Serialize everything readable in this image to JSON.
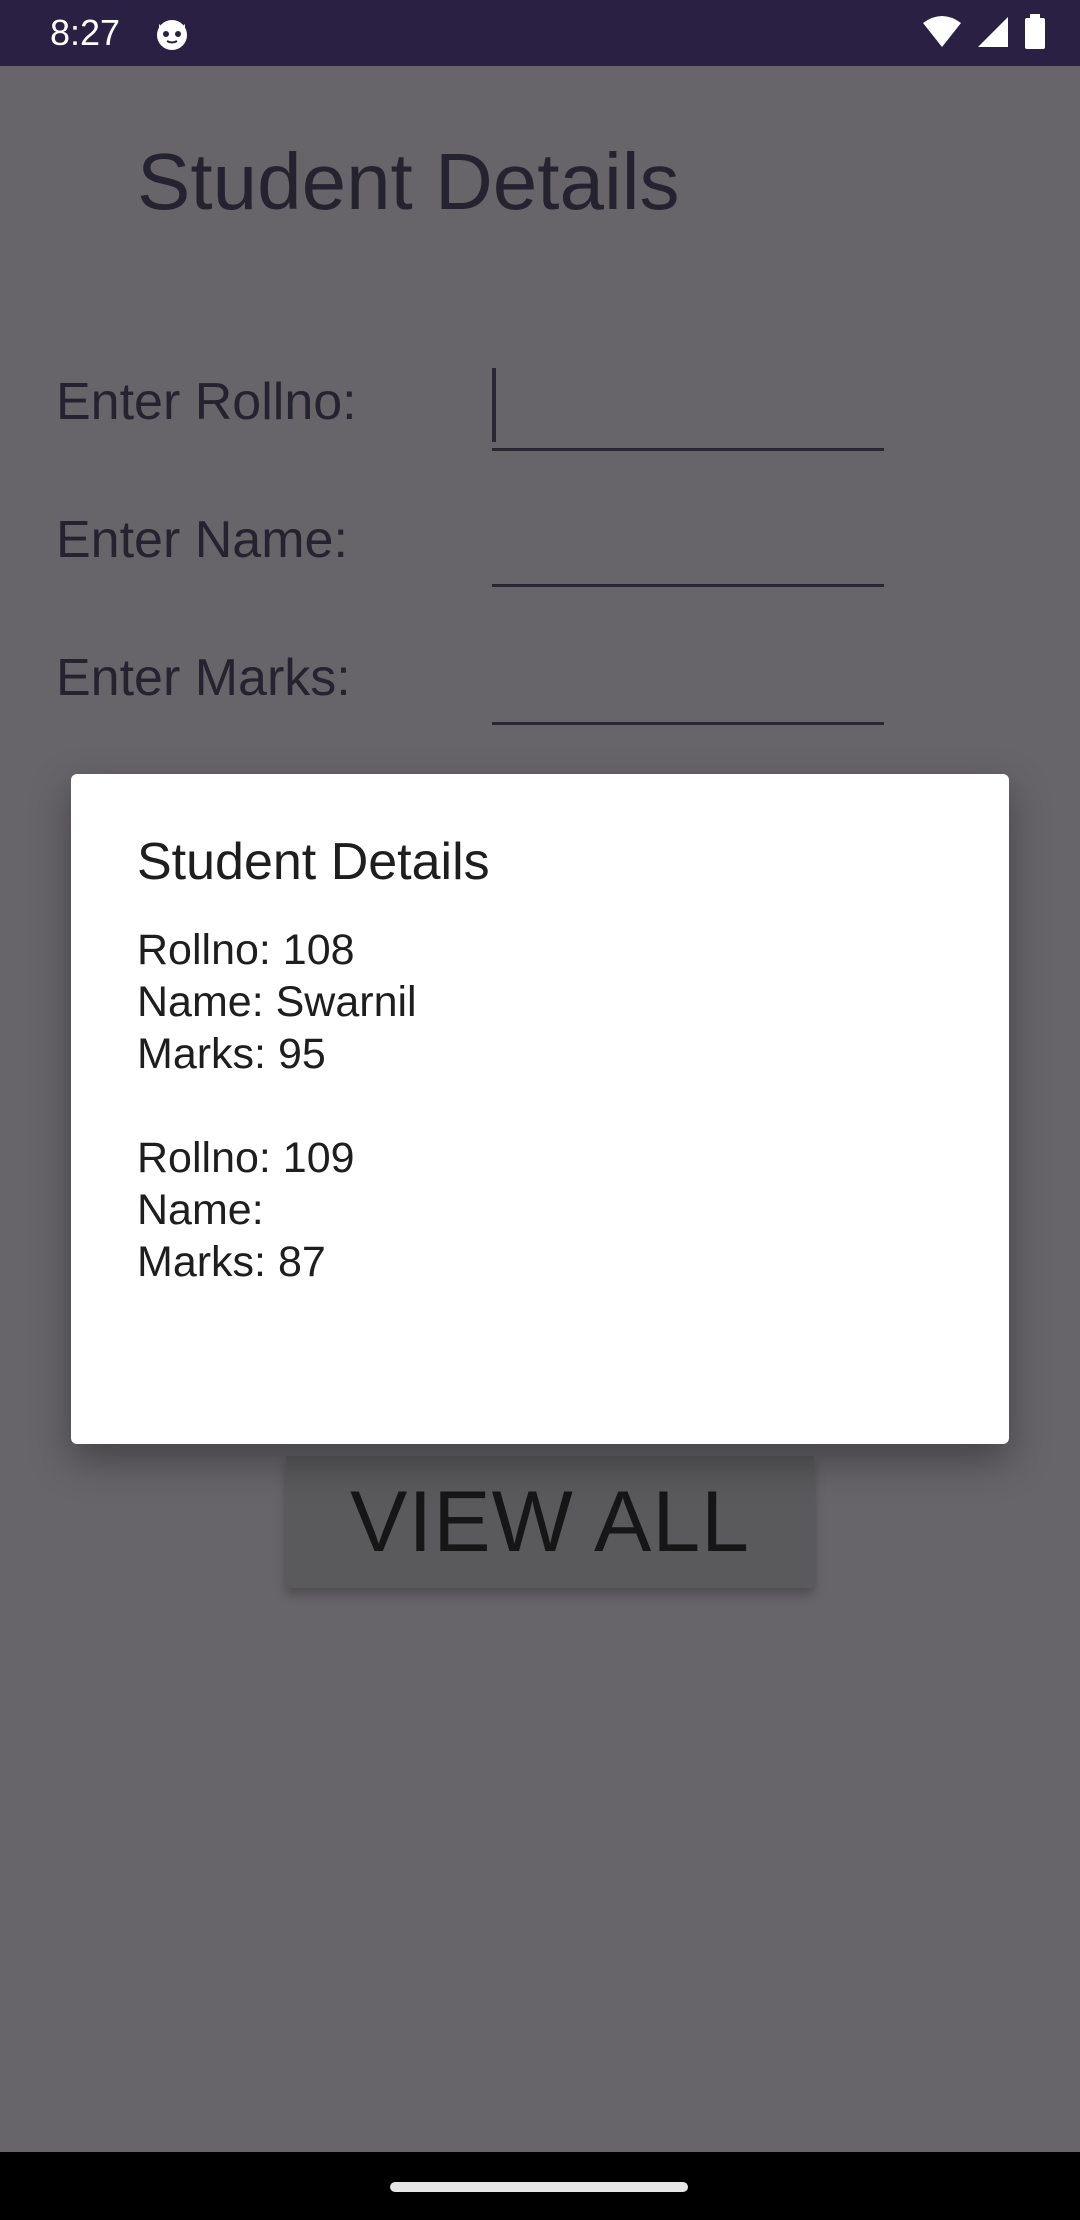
{
  "status_bar": {
    "time": "8:27",
    "icons": [
      "cat-face-icon",
      "wifi-icon",
      "signal-icon",
      "battery-icon"
    ],
    "background": "#2a2044"
  },
  "screen": {
    "title": "Student Details",
    "form": {
      "rollno_label": "Enter Rollno:",
      "rollno_value": "",
      "name_label": "Enter Name:",
      "name_value": "",
      "marks_label": "Enter Marks:",
      "marks_value": ""
    },
    "view_all_label": "VIEW ALL"
  },
  "dialog": {
    "title": "Student Details",
    "records": [
      {
        "rollno": "Rollno: 108",
        "name": "Name: Swarnil",
        "marks": "Marks: 95"
      },
      {
        "rollno": "Rollno: 109",
        "name": "Name:",
        "marks": "Marks: 87"
      }
    ]
  },
  "colors": {
    "scrim": "#67656a",
    "dialog_bg": "#ffffff",
    "text_dark": "#1e1e1e"
  }
}
